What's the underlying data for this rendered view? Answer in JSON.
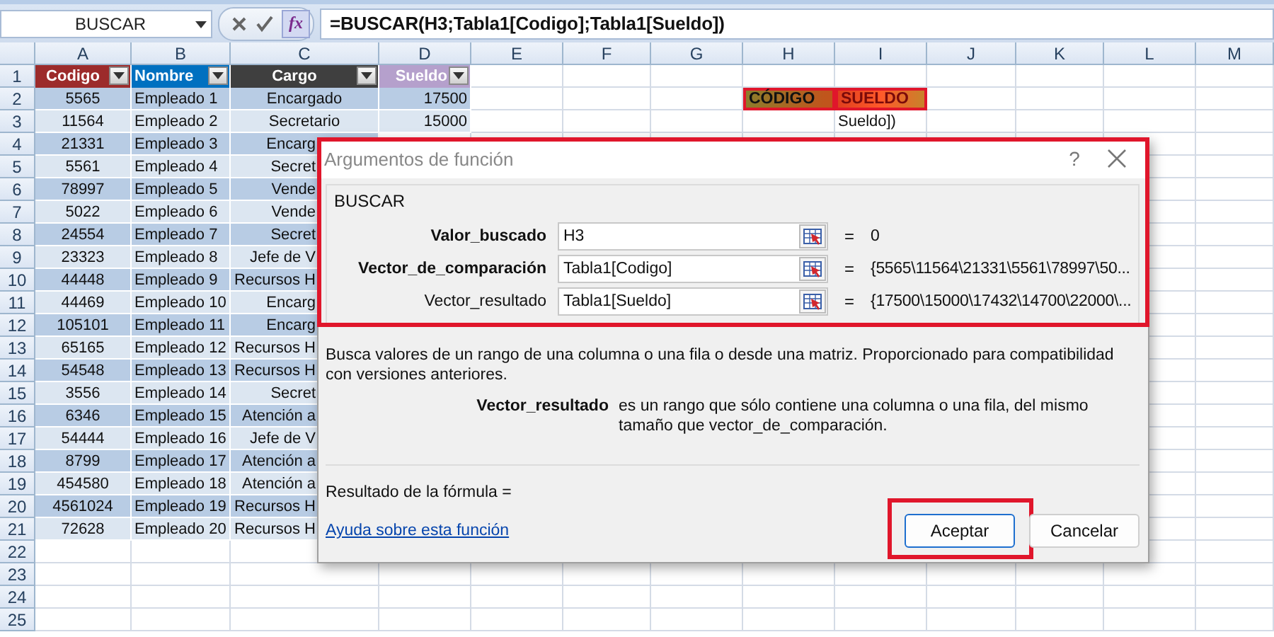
{
  "formula_bar": {
    "name_box": "BUSCAR",
    "function_button": "fx",
    "formula": "=BUSCAR(H3;Tabla1[Codigo];Tabla1[Sueldo])"
  },
  "sheet": {
    "columns": [
      "A",
      "B",
      "C",
      "D",
      "E",
      "F",
      "G",
      "H",
      "I",
      "J",
      "K",
      "L",
      "M"
    ],
    "rows": [
      {
        "number": "1",
        "cells": [
          {
            "text": "Codigo",
            "kind": "header",
            "color": "#9c2b2b"
          },
          {
            "text": "Nombre",
            "kind": "header",
            "color": "#0070c0"
          },
          {
            "text": "Cargo",
            "kind": "header",
            "color": "#3f3f3f"
          },
          {
            "text": "Sueldo",
            "kind": "header",
            "color": "#b5a0cc"
          }
        ]
      },
      {
        "number": "2",
        "cells": [
          {
            "text": "5565",
            "kind": "data"
          },
          {
            "text": "Empleado 1",
            "kind": "data"
          },
          {
            "text": "Encargado",
            "kind": "data"
          },
          {
            "text": "17500",
            "kind": "data"
          },
          null,
          null,
          null,
          {
            "text": "CÓDIGO",
            "kind": "highlight",
            "color": "#8b7d2b",
            "highlighted": true
          },
          {
            "text": "SUELDO",
            "kind": "highlight",
            "color": "#e0401e",
            "highlighted": true
          }
        ]
      },
      {
        "number": "3",
        "cells": [
          {
            "text": "11564",
            "kind": "data"
          },
          {
            "text": "Empleado 2",
            "kind": "data"
          },
          {
            "text": "Secretario",
            "kind": "data"
          },
          {
            "text": "15000",
            "kind": "data"
          },
          null,
          null,
          null,
          null,
          {
            "text": "Sueldo])",
            "kind": "plain"
          }
        ]
      },
      {
        "number": "4",
        "cells": [
          {
            "text": "21331",
            "kind": "data"
          },
          {
            "text": "Empleado 3",
            "kind": "data"
          },
          {
            "text": "Encarg",
            "kind": "clipped"
          }
        ]
      },
      {
        "number": "5",
        "cells": [
          {
            "text": "5561",
            "kind": "data"
          },
          {
            "text": "Empleado 4",
            "kind": "data"
          },
          {
            "text": "Secret",
            "kind": "clipped"
          }
        ]
      },
      {
        "number": "6",
        "cells": [
          {
            "text": "78997",
            "kind": "data"
          },
          {
            "text": "Empleado 5",
            "kind": "data"
          },
          {
            "text": "Vende",
            "kind": "clipped"
          }
        ]
      },
      {
        "number": "7",
        "cells": [
          {
            "text": "5022",
            "kind": "data"
          },
          {
            "text": "Empleado 6",
            "kind": "data"
          },
          {
            "text": "Vende",
            "kind": "clipped"
          }
        ]
      },
      {
        "number": "8",
        "cells": [
          {
            "text": "24554",
            "kind": "data"
          },
          {
            "text": "Empleado 7",
            "kind": "data"
          },
          {
            "text": "Secret",
            "kind": "clipped"
          }
        ]
      },
      {
        "number": "9",
        "cells": [
          {
            "text": "23323",
            "kind": "data"
          },
          {
            "text": "Empleado 8",
            "kind": "data"
          },
          {
            "text": "Jefe de V",
            "kind": "clipped"
          }
        ]
      },
      {
        "number": "10",
        "cells": [
          {
            "text": "44448",
            "kind": "data"
          },
          {
            "text": "Empleado 9",
            "kind": "data"
          },
          {
            "text": "Recursos H",
            "kind": "clipped"
          }
        ]
      },
      {
        "number": "11",
        "cells": [
          {
            "text": "44469",
            "kind": "data"
          },
          {
            "text": "Empleado 10",
            "kind": "data"
          },
          {
            "text": "Encarg",
            "kind": "clipped"
          }
        ]
      },
      {
        "number": "12",
        "cells": [
          {
            "text": "105101",
            "kind": "data"
          },
          {
            "text": "Empleado 11",
            "kind": "data"
          },
          {
            "text": "Encarg",
            "kind": "clipped"
          }
        ]
      },
      {
        "number": "13",
        "cells": [
          {
            "text": "65165",
            "kind": "data"
          },
          {
            "text": "Empleado 12",
            "kind": "data"
          },
          {
            "text": "Recursos H",
            "kind": "clipped"
          }
        ]
      },
      {
        "number": "14",
        "cells": [
          {
            "text": "54548",
            "kind": "data"
          },
          {
            "text": "Empleado 13",
            "kind": "data"
          },
          {
            "text": "Recursos H",
            "kind": "clipped"
          }
        ]
      },
      {
        "number": "15",
        "cells": [
          {
            "text": "3556",
            "kind": "data"
          },
          {
            "text": "Empleado 14",
            "kind": "data"
          },
          {
            "text": "Secret",
            "kind": "clipped"
          }
        ]
      },
      {
        "number": "16",
        "cells": [
          {
            "text": "6346",
            "kind": "data"
          },
          {
            "text": "Empleado 15",
            "kind": "data"
          },
          {
            "text": "Atención a",
            "kind": "clipped"
          }
        ]
      },
      {
        "number": "17",
        "cells": [
          {
            "text": "54444",
            "kind": "data"
          },
          {
            "text": "Empleado 16",
            "kind": "data"
          },
          {
            "text": "Jefe de V",
            "kind": "clipped"
          }
        ]
      },
      {
        "number": "18",
        "cells": [
          {
            "text": "8799",
            "kind": "data"
          },
          {
            "text": "Empleado 17",
            "kind": "data"
          },
          {
            "text": "Atención a",
            "kind": "clipped"
          }
        ]
      },
      {
        "number": "19",
        "cells": [
          {
            "text": "454580",
            "kind": "data"
          },
          {
            "text": "Empleado 18",
            "kind": "data"
          },
          {
            "text": "Atención a",
            "kind": "clipped"
          }
        ]
      },
      {
        "number": "20",
        "cells": [
          {
            "text": "4561024",
            "kind": "data"
          },
          {
            "text": "Empleado 19",
            "kind": "data"
          },
          {
            "text": "Recursos H",
            "kind": "clipped"
          }
        ]
      },
      {
        "number": "21",
        "cells": [
          {
            "text": "72628",
            "kind": "data"
          },
          {
            "text": "Empleado 20",
            "kind": "data"
          },
          {
            "text": "Recursos H",
            "kind": "clipped"
          }
        ]
      },
      {
        "number": "22"
      },
      {
        "number": "23"
      },
      {
        "number": "24"
      },
      {
        "number": "25"
      }
    ]
  },
  "dialog": {
    "title": "Argumentos de función",
    "help_button": "?",
    "function_name": "BUSCAR",
    "arguments_highlighted": true,
    "arguments": [
      {
        "label": "Valor_buscado",
        "required": true,
        "value": "H3",
        "equals": "=",
        "result": "0"
      },
      {
        "label": "Vector_de_comparación",
        "required": true,
        "value": "Tabla1[Codigo]",
        "equals": "=",
        "result": "{5565\\11564\\21331\\5561\\78997\\50..."
      },
      {
        "label": "Vector_resultado",
        "required": false,
        "value": "Tabla1[Sueldo]",
        "equals": "=",
        "result": "{17500\\15000\\17432\\14700\\22000\\..."
      }
    ],
    "description": "Busca valores de un rango de una columna o una fila o desde una matriz. Proporcionado para compatibilidad con versiones anteriores.",
    "argument_help": {
      "name": "Vector_resultado",
      "text": "es un rango que sólo contiene una columna o una fila, del mismo tamaño que vector_de_comparación."
    },
    "result_label": "Resultado de la fórmula =",
    "help_link": "Ayuda sobre esta función",
    "buttons": [
      {
        "label": "Aceptar",
        "focused": true,
        "highlighted": true
      },
      {
        "label": "Cancelar",
        "focused": false,
        "highlighted": false
      }
    ]
  }
}
